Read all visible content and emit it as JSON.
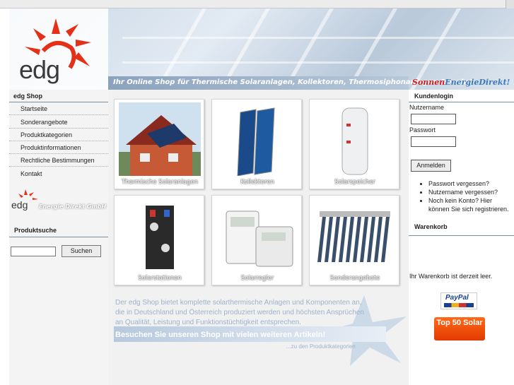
{
  "header": {
    "slogan": "Ihr Online Shop für Thermische Solaranlagen, Kollektoren, Thermosiphonanlagen & mehr!",
    "logo_text": "edg",
    "brand_part1": "Sonnen",
    "brand_part2": "EnergieDirekt!"
  },
  "sidebar": {
    "title": "edg Shop",
    "items": [
      {
        "label": "Startseite"
      },
      {
        "label": "Sonderangebote"
      },
      {
        "label": "Produktkategorien"
      },
      {
        "label": "Produktinformationen"
      },
      {
        "label": "Rechtliche Bestimmungen"
      },
      {
        "label": "Kontakt"
      }
    ],
    "logo_text": "edg",
    "logo_sub": "Energie Direkt GmbH",
    "search_title": "Produktsuche",
    "search_button": "Suchen"
  },
  "main": {
    "tiles": [
      {
        "label": "Thermische Solaranlagen"
      },
      {
        "label": "Kollektoren"
      },
      {
        "label": "Solarspeicher"
      },
      {
        "label": "Solarstationen"
      },
      {
        "label": "Solarregler"
      },
      {
        "label": "Sonderangebote"
      }
    ],
    "about": "Der edg Shop bietet komplette solarthermische Anlagen und Komponenten an, die in Deutschland und Österreich produziert werden und höchsten Ansprüchen an Qualität, Leistung und Funktionstüchtigkeit entsprechen.",
    "cta": "Besuchen Sie unseren Shop mit vielen weiteren Artikeln!",
    "cta_link": "...zu den Produktkategorien"
  },
  "right": {
    "login_title": "Kundenlogin",
    "username_label": "Nutzername",
    "password_label": "Passwort",
    "login_button": "Anmelden",
    "links": [
      "Passwort vergessen?",
      "Nutzername vergessen?",
      "Noch kein Konto? Hier können Sie sich registrieren."
    ],
    "cart_title": "Warenkorb",
    "cart_empty": "Ihr Warenkorb ist derzeit leer.",
    "paypal": "PayPal",
    "top50": "Top 50 Solar"
  },
  "colors": {
    "accent_red": "#d31a1a",
    "accent_blue": "#3c78b8",
    "rule": "#7c8da0"
  }
}
